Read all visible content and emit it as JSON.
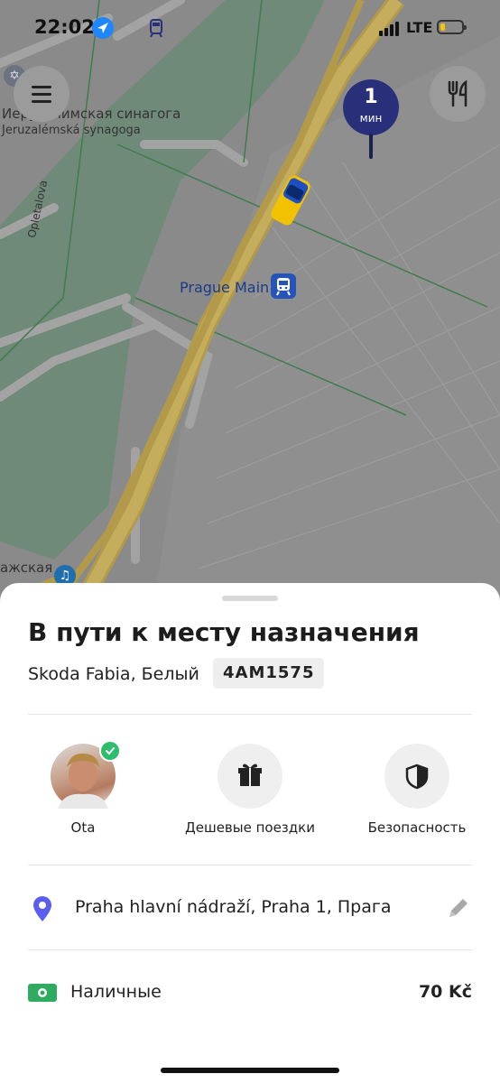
{
  "status_bar": {
    "time": "22:02",
    "network": "LTE"
  },
  "map": {
    "synagogue_ru": "Иерусалимская синагога",
    "synagogue_cz": "Jeruzalémská synagoga",
    "street_name": "Opletalova",
    "station_label": "Prague Main",
    "bottom_label": "ажская",
    "eta_value": "1",
    "eta_unit": "мин"
  },
  "trip": {
    "title": "В пути к месту назначения",
    "car_description": "Skoda Fabia, Белый",
    "plate": "4AM1575"
  },
  "actions": [
    {
      "label": "Ota",
      "icon": "driver-avatar"
    },
    {
      "label": "Дешевые поездки",
      "icon": "gift-icon"
    },
    {
      "label": "Безопасность",
      "icon": "shield-icon"
    }
  ],
  "destination": {
    "address": "Praha hlavní nádraží, Praha 1, Прага"
  },
  "payment": {
    "method": "Наличные",
    "amount": "70 Kč"
  },
  "colors": {
    "accent": "#2a2f7a",
    "verified": "#2ebd6b",
    "pin": "#5b5cf0",
    "cash": "#2eab5f"
  }
}
